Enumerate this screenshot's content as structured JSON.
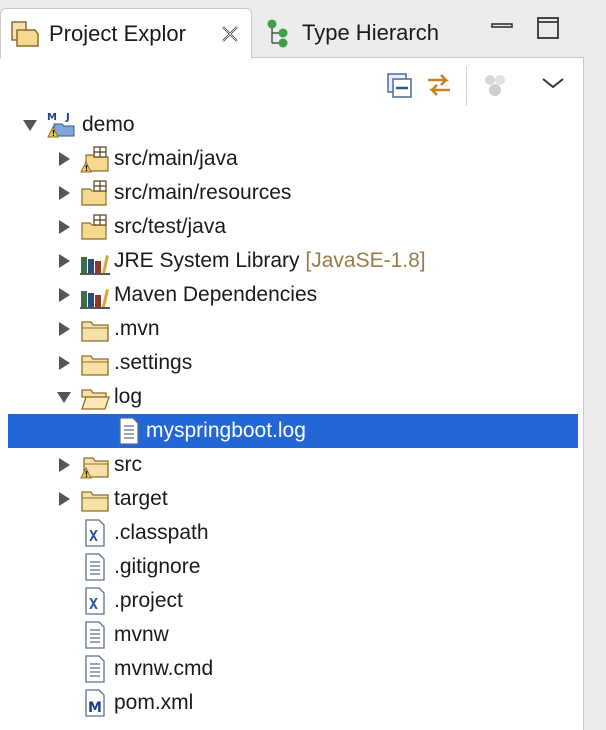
{
  "tabs": [
    {
      "label": "Project Explor",
      "active": true
    },
    {
      "label": "Type Hierarch",
      "active": false
    }
  ],
  "toolbar": {
    "collapse_all_icon": "collapse-all-icon",
    "link_with_editor_icon": "link-with-editor-icon",
    "focus_icon": "focus-icon",
    "view_menu_icon": "view-menu-icon"
  },
  "colors": {
    "selection": "#2366d6",
    "decoration": "#9b7a4a"
  },
  "tree": {
    "items": [
      {
        "label": "demo",
        "decoration": "",
        "icon": "maven-project-icon",
        "expanded": true
      },
      {
        "label": "src/main/java",
        "decoration": "",
        "icon": "package-folder-icon",
        "expanded": false
      },
      {
        "label": "src/main/resources",
        "decoration": "",
        "icon": "package-folder-icon",
        "expanded": false
      },
      {
        "label": "src/test/java",
        "decoration": "",
        "icon": "package-folder-icon",
        "expanded": false
      },
      {
        "label": "JRE System Library",
        "decoration": "[JavaSE-1.8]",
        "icon": "library-icon",
        "expanded": false
      },
      {
        "label": "Maven Dependencies",
        "decoration": "",
        "icon": "library-icon",
        "expanded": false
      },
      {
        "label": ".mvn",
        "decoration": "",
        "icon": "folder-icon",
        "expanded": false
      },
      {
        "label": ".settings",
        "decoration": "",
        "icon": "folder-icon",
        "expanded": false
      },
      {
        "label": "log",
        "decoration": "",
        "icon": "folder-open-icon",
        "expanded": true
      },
      {
        "label": "myspringboot.log",
        "decoration": "",
        "icon": "text-file-icon",
        "selected": true
      },
      {
        "label": "src",
        "decoration": "",
        "icon": "folder-icon",
        "expanded": false
      },
      {
        "label": "target",
        "decoration": "",
        "icon": "folder-icon",
        "expanded": false
      },
      {
        "label": ".classpath",
        "decoration": "",
        "icon": "xml-file-icon"
      },
      {
        "label": ".gitignore",
        "decoration": "",
        "icon": "text-file-icon"
      },
      {
        "label": ".project",
        "decoration": "",
        "icon": "xml-file-icon"
      },
      {
        "label": "mvnw",
        "decoration": "",
        "icon": "text-file-icon"
      },
      {
        "label": "mvnw.cmd",
        "decoration": "",
        "icon": "text-file-icon"
      },
      {
        "label": "pom.xml",
        "decoration": "",
        "icon": "maven-pom-icon"
      }
    ]
  }
}
